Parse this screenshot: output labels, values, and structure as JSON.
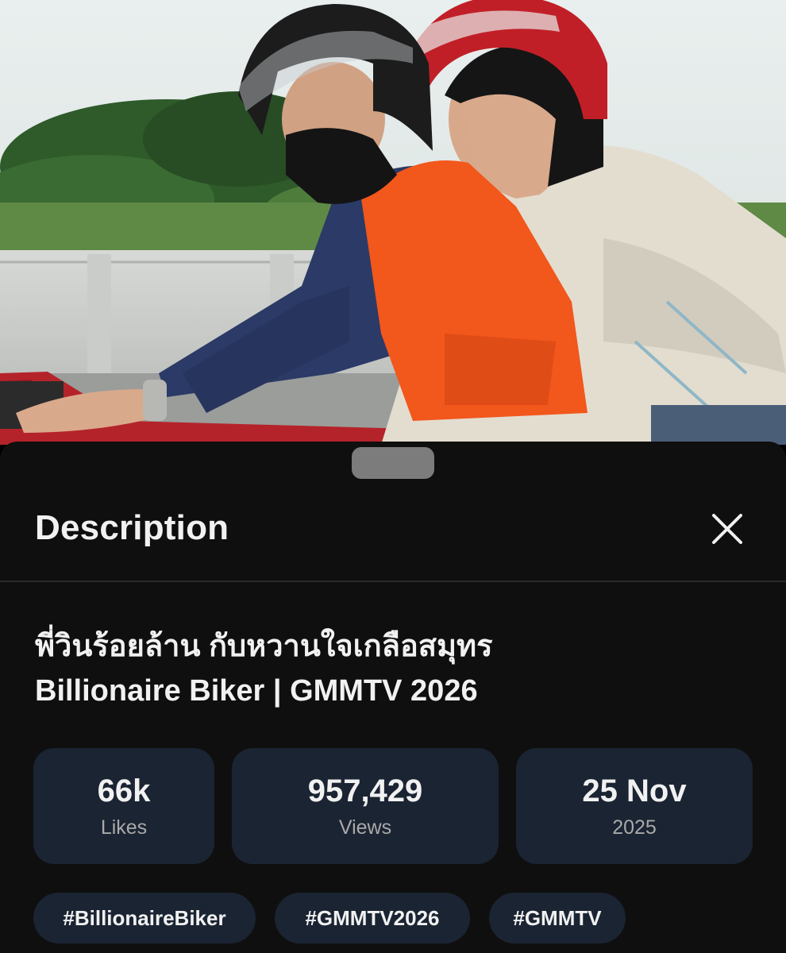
{
  "sheet": {
    "title": "Description",
    "close_icon": "close-icon"
  },
  "video": {
    "title_line1": "พี่วินร้อยล้าน กับหวานใจเกลือสมุทร",
    "title_line2": "Billionaire Biker | GMMTV 2026"
  },
  "stats": [
    {
      "value": "66k",
      "label": "Likes"
    },
    {
      "value": "957,429",
      "label": "Views"
    },
    {
      "value": "25 Nov",
      "label": "2025"
    }
  ],
  "hashtags": [
    "#BillionaireBiker",
    "#GMMTV2026",
    "#GMMTV"
  ],
  "colors": {
    "sheet_bg": "#0f0f0f",
    "card_bg": "#1b2433",
    "text_primary": "#f1f1f1",
    "text_secondary": "#a9a9a9"
  }
}
